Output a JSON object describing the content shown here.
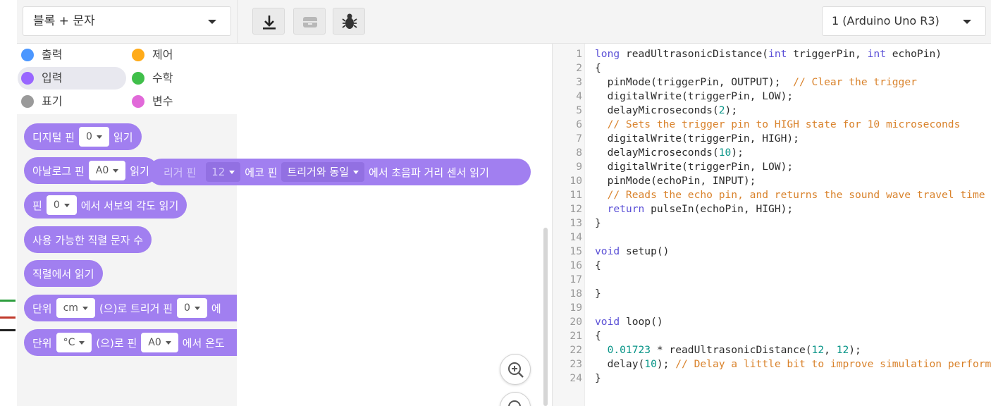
{
  "toolbar": {
    "mode_select": "블록 + 문자",
    "board_select": "1 (Arduino Uno R3)",
    "buttons": [
      "download-icon",
      "serial-monitor-icon",
      "debug-bug-icon"
    ]
  },
  "categories": [
    {
      "label": "출력",
      "color": "#4c97ff"
    },
    {
      "label": "제어",
      "color": "#ffab19"
    },
    {
      "label": "입력",
      "color": "#9966ff",
      "active": true
    },
    {
      "label": "수학",
      "color": "#40bf4a"
    },
    {
      "label": "표기",
      "color": "#9a9a9a"
    },
    {
      "label": "변수",
      "color": "#e169d9"
    }
  ],
  "blocks": {
    "digital_pin": {
      "label": "디지털 핀",
      "value": "0",
      "suffix": "읽기"
    },
    "analog_pin": {
      "label": "아날로그 핀",
      "value": "A0",
      "suffix": "읽기"
    },
    "servo": {
      "prefix": "핀",
      "value": "0",
      "suffix": "에서 서보의 각도 읽기"
    },
    "serial_available": {
      "label": "사용 가능한 직렬 문자 수"
    },
    "serial_read": {
      "label": "직렬에서 읽기"
    },
    "ultrasonic": {
      "prefix": "단위",
      "unit": "cm",
      "mid": "(으)로 트리거 핀",
      "value": "0",
      "tail": "에"
    },
    "temperature": {
      "prefix": "단위",
      "unit": "°C",
      "mid": "(으)로 핀",
      "value": "A0",
      "tail": "에서 온도"
    }
  },
  "drag_block": {
    "trigger_label": "리거 핀",
    "trigger_value": "12",
    "echo_label": "에코 핀",
    "echo_value": "트리거와 동일",
    "suffix": "에서 초음파 거리 센서 읽기"
  },
  "code": {
    "line_numbers": [
      "1",
      "2",
      "3",
      "4",
      "5",
      "6",
      "7",
      "8",
      "9",
      "10",
      "11",
      "12",
      "13",
      "14",
      "15",
      "16",
      "17",
      "18",
      "19",
      "20",
      "21",
      "22",
      "23",
      "24"
    ],
    "lines": [
      {
        "kw": "long",
        "text": " readUltrasonicDistance(",
        "kw2": "int",
        "text2": " triggerPin, ",
        "kw3": "int",
        "text3": " echoPin)"
      },
      {
        "text": "{"
      },
      {
        "text": "  pinMode(triggerPin, OUTPUT);  ",
        "comment": "// Clear the trigger"
      },
      {
        "text": "  digitalWrite(triggerPin, LOW);"
      },
      {
        "text": "  delayMicroseconds(",
        "num": "2",
        "text2": ");"
      },
      {
        "comment": "  // Sets the trigger pin to HIGH state for 10 microseconds"
      },
      {
        "text": "  digitalWrite(triggerPin, HIGH);"
      },
      {
        "text": "  delayMicroseconds(",
        "num": "10",
        "text2": ");"
      },
      {
        "text": "  digitalWrite(triggerPin, LOW);"
      },
      {
        "text": "  pinMode(echoPin, INPUT);"
      },
      {
        "comment": "  // Reads the echo pin, and returns the sound wave travel time"
      },
      {
        "kw": "  return",
        "text": " pulseIn(echoPin, HIGH);"
      },
      {
        "text": "}"
      },
      {
        "text": ""
      },
      {
        "kw": "void",
        "text": " setup()"
      },
      {
        "text": "{"
      },
      {
        "text": ""
      },
      {
        "text": "}"
      },
      {
        "text": ""
      },
      {
        "kw": "void",
        "text": " loop()"
      },
      {
        "text": "{"
      },
      {
        "num": "  0.01723",
        "text": " * readUltrasonicDistance(",
        "num2": "12",
        "text2": ", ",
        "num3": "12",
        "text3": ");"
      },
      {
        "text": "  delay(",
        "num": "10",
        "text2": "); ",
        "comment": "// Delay a little bit to improve simulation performance"
      },
      {
        "text": "}"
      }
    ]
  }
}
